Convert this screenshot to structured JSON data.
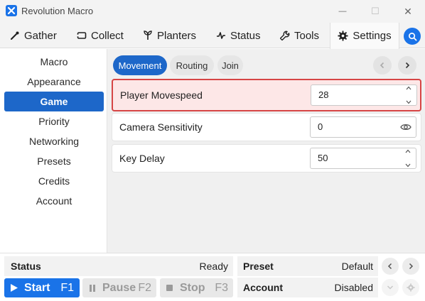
{
  "window": {
    "title": "Revolution Macro",
    "minimize_glyph": "—",
    "maximize_glyph": "☐",
    "close_glyph": "✕"
  },
  "tabs": [
    {
      "label": "Gather",
      "icon": "wand-icon"
    },
    {
      "label": "Collect",
      "icon": "ticket-icon"
    },
    {
      "label": "Planters",
      "icon": "sprout-icon"
    },
    {
      "label": "Status",
      "icon": "pulse-icon"
    },
    {
      "label": "Tools",
      "icon": "wrench-icon"
    },
    {
      "label": "Settings",
      "icon": "gear-icon",
      "active": true
    }
  ],
  "sidebar": {
    "items": [
      {
        "label": "Macro"
      },
      {
        "label": "Appearance"
      },
      {
        "label": "Game",
        "active": true
      },
      {
        "label": "Priority"
      },
      {
        "label": "Networking"
      },
      {
        "label": "Presets"
      },
      {
        "label": "Credits"
      },
      {
        "label": "Account"
      }
    ]
  },
  "subtabs": [
    {
      "label": "Movement",
      "active": true
    },
    {
      "label": "Routing"
    },
    {
      "label": "Join"
    }
  ],
  "settings": [
    {
      "label": "Player Movespeed",
      "value": "28",
      "control": "stepper",
      "highlighted": true
    },
    {
      "label": "Camera Sensitivity",
      "value": "0",
      "control": "eye"
    },
    {
      "label": "Key Delay",
      "value": "50",
      "control": "stepper"
    }
  ],
  "status": {
    "label": "Status",
    "value": "Ready",
    "preset_label": "Preset",
    "preset_value": "Default",
    "account_label": "Account",
    "account_value": "Disabled"
  },
  "controls": {
    "start": {
      "label": "Start",
      "key": "F1"
    },
    "pause": {
      "label": "Pause",
      "key": "F2"
    },
    "stop": {
      "label": "Stop",
      "key": "F3"
    }
  },
  "colors": {
    "accent": "#1a73e8",
    "active_nav": "#1d67c9",
    "highlight_border": "#d64545",
    "highlight_bg": "#fde7e7"
  }
}
